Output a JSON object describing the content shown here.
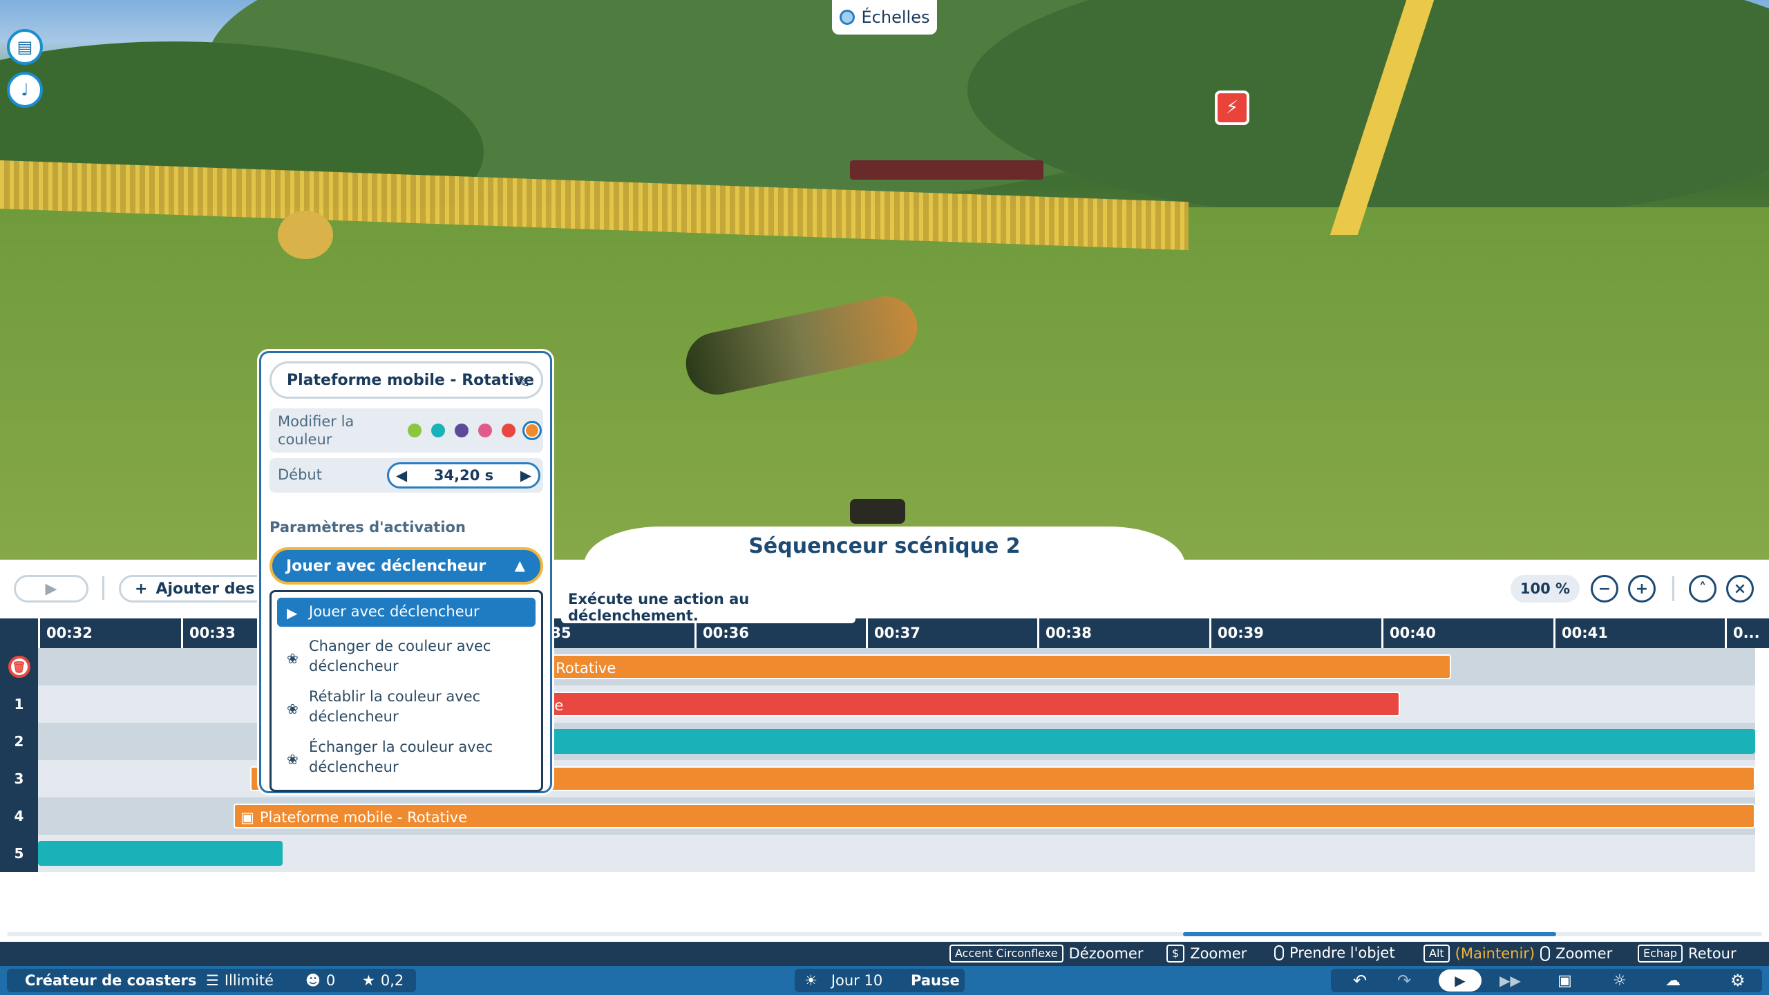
{
  "top": {
    "scales_label": "Échelles"
  },
  "sequencer": {
    "title": "Séquenceur scénique 2"
  },
  "toolbar": {
    "add_label": "Ajouter des él",
    "zoom_value": "100 %"
  },
  "ruler": {
    "ticks": [
      "00:32",
      "00:33",
      ":35",
      "00:36",
      "00:37",
      "00:38",
      "00:39",
      "00:40",
      "00:41",
      "0..."
    ]
  },
  "rows": {
    "labels": [
      "1",
      "2",
      "3",
      "4",
      "5"
    ],
    "r0_bar": "- Rotative",
    "r1_bar": "ve",
    "r4_bar": "Plateforme mobile - Rotative"
  },
  "popup": {
    "title": "Plateforme mobile - Rotative",
    "color_label": "Modifier la couleur",
    "start_label": "Début",
    "start_value": "34,20 s",
    "section_label": "Paramètres d'activation",
    "dropdown_value": "Jouer avec déclencheur",
    "menu": [
      "Jouer avec déclencheur",
      "Changer de couleur avec déclencheur",
      "Rétablir la couleur avec déclencheur",
      "Échanger la couleur avec déclencheur"
    ],
    "colors": [
      "#8cc63f",
      "#19b2b8",
      "#5b4a9a",
      "#e05b8a",
      "#e8483f",
      "#f08a2f"
    ]
  },
  "tooltip": "Exécute une action au déclenchement.",
  "hints": {
    "k1": "Accent Circonflexe",
    "t1": "Dézoomer",
    "k2": "$",
    "t2": "Zoomer",
    "t3": "Prendre l'objet",
    "k4": "Alt",
    "t4a": "(Maintenir)",
    "t4b": "Zoomer",
    "k5": "Echap",
    "t5": "Retour"
  },
  "status": {
    "app": "Créateur de coasters",
    "money": "Illimité",
    "guests": "0",
    "rating": "0,2",
    "day": "Jour 10",
    "pause": "Pause"
  }
}
